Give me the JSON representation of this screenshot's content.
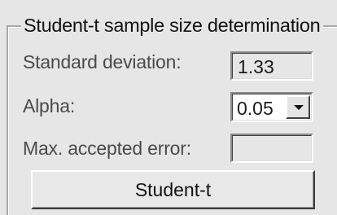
{
  "groupbox": {
    "title": "Student-t sample size determination"
  },
  "fields": {
    "standard_deviation": {
      "label": "Standard deviation:",
      "value": "1.33"
    },
    "alpha": {
      "label": "Alpha:",
      "value": "0.05",
      "dropdown_icon": "chevron-down-icon"
    },
    "max_accepted_error": {
      "label": "Max. accepted error:",
      "value": ""
    }
  },
  "actions": {
    "student_t_button": "Student-t"
  }
}
